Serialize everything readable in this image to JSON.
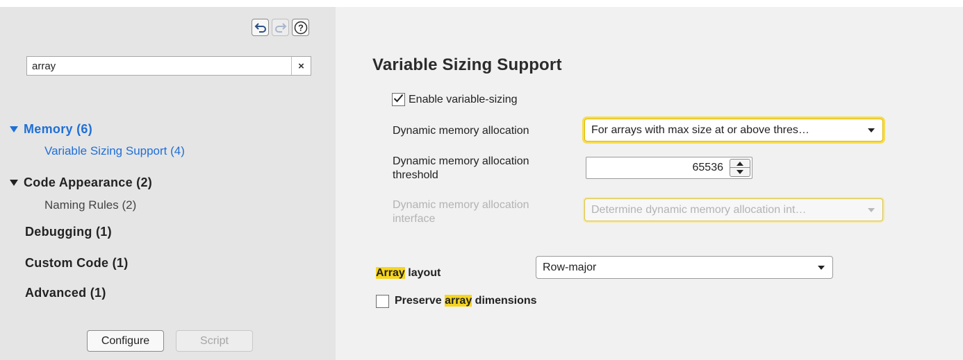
{
  "toolbar": {
    "back_icon": "back-arrow-icon",
    "forward_icon": "forward-arrow-icon",
    "help_icon": "help-icon"
  },
  "search": {
    "value": "array",
    "clear_label": "×"
  },
  "tree": {
    "groups": [
      {
        "label": "Memory (6)",
        "expanded": true,
        "active": true,
        "children": [
          {
            "label": "Variable Sizing Support (4)",
            "active": true
          }
        ]
      },
      {
        "label": "Code Appearance (2)",
        "expanded": true,
        "active": false,
        "children": [
          {
            "label": "Naming Rules (2)",
            "active": false
          }
        ]
      },
      {
        "label": "Debugging (1)"
      },
      {
        "label": "Custom Code (1)"
      },
      {
        "label": "Advanced (1)"
      }
    ]
  },
  "footer": {
    "configure_label": "Configure",
    "script_label": "Script"
  },
  "main": {
    "section_title": "Variable Sizing Support",
    "enable_variable_sizing": {
      "label": "Enable variable-sizing",
      "checked": true
    },
    "dynamic_alloc": {
      "label": "Dynamic memory allocation",
      "value": "For arrays with max size at or above thres…"
    },
    "dynamic_alloc_threshold": {
      "label_line1": "Dynamic memory allocation",
      "label_line2": "threshold",
      "value": "65536"
    },
    "dynamic_alloc_interface": {
      "label_line1": "Dynamic memory allocation",
      "label_line2": "interface",
      "value": "Determine dynamic memory allocation int…",
      "disabled": true
    },
    "array_layout": {
      "label_highlight": "Array",
      "label_rest": " layout",
      "value": "Row-major"
    },
    "preserve_dims": {
      "label_pre": "Preserve ",
      "label_highlight": "array",
      "label_post": " dimensions",
      "checked": false
    }
  },
  "colors": {
    "left_panel_bg": "#e5e5e5",
    "right_panel_bg": "#f1f1f1",
    "active_link": "#1f6fd6",
    "search_highlight": "#f7d51d",
    "focus_ring": "#f6dc4f"
  }
}
